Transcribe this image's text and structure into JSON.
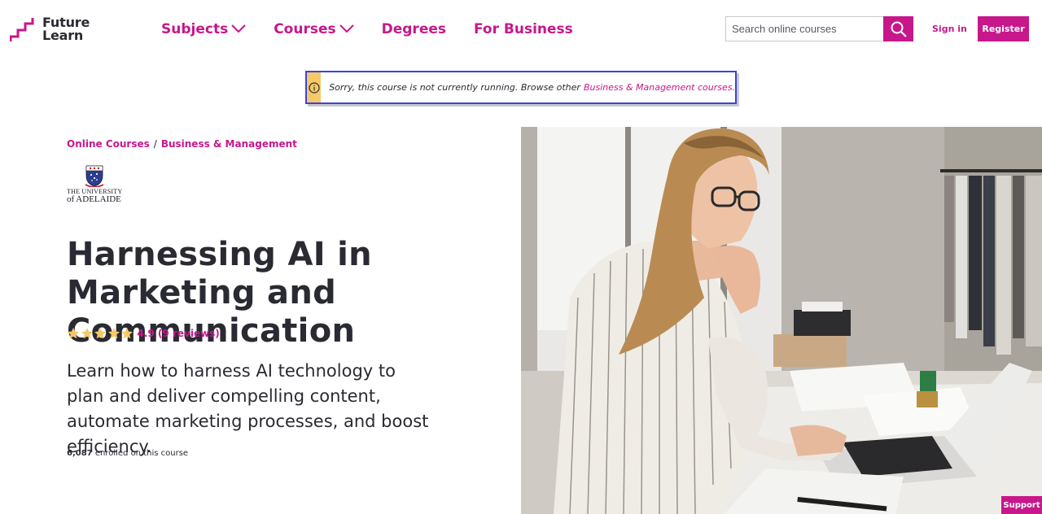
{
  "header": {
    "logo": {
      "line1": "Future",
      "line2": "Learn"
    },
    "nav": [
      {
        "label": "Subjects",
        "dropdown": true
      },
      {
        "label": "Courses",
        "dropdown": true
      },
      {
        "label": "Degrees",
        "dropdown": false
      },
      {
        "label": "For Business",
        "dropdown": false
      }
    ],
    "search": {
      "placeholder": "Search online courses"
    },
    "sign_in": "Sign in",
    "register": "Register"
  },
  "notice": {
    "text": "Sorry, this course is not currently running. Browse other",
    "link": "Business & Management courses."
  },
  "breadcrumb": [
    {
      "label": "Online Courses"
    },
    {
      "label": "Business & Management"
    }
  ],
  "breadcrumb_separator": "/",
  "university": {
    "line1": "THE UNIVERSITY",
    "line2": "of ADELAIDE"
  },
  "course": {
    "title": "Harnessing AI in Marketing and Communication",
    "rating_value": 4.9,
    "rating_text": "4.9 (9 reviews)",
    "stars_total": 5,
    "description": "Learn how to harness AI technology to plan and deliver compelling content, automate marketing processes, and boost efficiency.",
    "enrolled_count": "6,087",
    "enrolled_suffix": "enrolled on this course"
  },
  "support_button": "Support",
  "colors": {
    "brand": "#c7178b",
    "notice_border": "#3a44d8",
    "notice_icon_bg": "#f5c968",
    "star": "#f5c968",
    "text": "#2a2a33"
  },
  "icons": [
    "futurelearn-logo-icon",
    "chevron-down-icon",
    "search-icon",
    "info-icon",
    "star-icon",
    "university-crest-icon"
  ]
}
